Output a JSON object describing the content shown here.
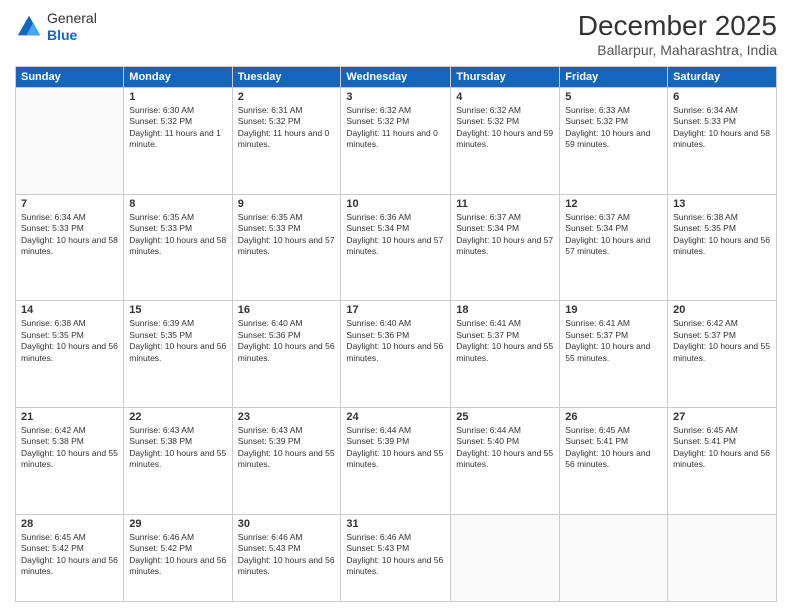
{
  "header": {
    "logo_general": "General",
    "logo_blue": "Blue",
    "month_year": "December 2025",
    "location": "Ballarpur, Maharashtra, India"
  },
  "days_of_week": [
    "Sunday",
    "Monday",
    "Tuesday",
    "Wednesday",
    "Thursday",
    "Friday",
    "Saturday"
  ],
  "weeks": [
    [
      {
        "num": "",
        "empty": true
      },
      {
        "num": "1",
        "sunrise": "6:30 AM",
        "sunset": "5:32 PM",
        "daylight": "11 hours and 1 minute."
      },
      {
        "num": "2",
        "sunrise": "6:31 AM",
        "sunset": "5:32 PM",
        "daylight": "11 hours and 0 minutes."
      },
      {
        "num": "3",
        "sunrise": "6:32 AM",
        "sunset": "5:32 PM",
        "daylight": "11 hours and 0 minutes."
      },
      {
        "num": "4",
        "sunrise": "6:32 AM",
        "sunset": "5:32 PM",
        "daylight": "10 hours and 59 minutes."
      },
      {
        "num": "5",
        "sunrise": "6:33 AM",
        "sunset": "5:32 PM",
        "daylight": "10 hours and 59 minutes."
      },
      {
        "num": "6",
        "sunrise": "6:34 AM",
        "sunset": "5:33 PM",
        "daylight": "10 hours and 58 minutes."
      }
    ],
    [
      {
        "num": "7",
        "sunrise": "6:34 AM",
        "sunset": "5:33 PM",
        "daylight": "10 hours and 58 minutes."
      },
      {
        "num": "8",
        "sunrise": "6:35 AM",
        "sunset": "5:33 PM",
        "daylight": "10 hours and 58 minutes."
      },
      {
        "num": "9",
        "sunrise": "6:35 AM",
        "sunset": "5:33 PM",
        "daylight": "10 hours and 57 minutes."
      },
      {
        "num": "10",
        "sunrise": "6:36 AM",
        "sunset": "5:34 PM",
        "daylight": "10 hours and 57 minutes."
      },
      {
        "num": "11",
        "sunrise": "6:37 AM",
        "sunset": "5:34 PM",
        "daylight": "10 hours and 57 minutes."
      },
      {
        "num": "12",
        "sunrise": "6:37 AM",
        "sunset": "5:34 PM",
        "daylight": "10 hours and 57 minutes."
      },
      {
        "num": "13",
        "sunrise": "6:38 AM",
        "sunset": "5:35 PM",
        "daylight": "10 hours and 56 minutes."
      }
    ],
    [
      {
        "num": "14",
        "sunrise": "6:38 AM",
        "sunset": "5:35 PM",
        "daylight": "10 hours and 56 minutes."
      },
      {
        "num": "15",
        "sunrise": "6:39 AM",
        "sunset": "5:35 PM",
        "daylight": "10 hours and 56 minutes."
      },
      {
        "num": "16",
        "sunrise": "6:40 AM",
        "sunset": "5:36 PM",
        "daylight": "10 hours and 56 minutes."
      },
      {
        "num": "17",
        "sunrise": "6:40 AM",
        "sunset": "5:36 PM",
        "daylight": "10 hours and 56 minutes."
      },
      {
        "num": "18",
        "sunrise": "6:41 AM",
        "sunset": "5:37 PM",
        "daylight": "10 hours and 55 minutes."
      },
      {
        "num": "19",
        "sunrise": "6:41 AM",
        "sunset": "5:37 PM",
        "daylight": "10 hours and 55 minutes."
      },
      {
        "num": "20",
        "sunrise": "6:42 AM",
        "sunset": "5:37 PM",
        "daylight": "10 hours and 55 minutes."
      }
    ],
    [
      {
        "num": "21",
        "sunrise": "6:42 AM",
        "sunset": "5:38 PM",
        "daylight": "10 hours and 55 minutes."
      },
      {
        "num": "22",
        "sunrise": "6:43 AM",
        "sunset": "5:38 PM",
        "daylight": "10 hours and 55 minutes."
      },
      {
        "num": "23",
        "sunrise": "6:43 AM",
        "sunset": "5:39 PM",
        "daylight": "10 hours and 55 minutes."
      },
      {
        "num": "24",
        "sunrise": "6:44 AM",
        "sunset": "5:39 PM",
        "daylight": "10 hours and 55 minutes."
      },
      {
        "num": "25",
        "sunrise": "6:44 AM",
        "sunset": "5:40 PM",
        "daylight": "10 hours and 55 minutes."
      },
      {
        "num": "26",
        "sunrise": "6:45 AM",
        "sunset": "5:41 PM",
        "daylight": "10 hours and 56 minutes."
      },
      {
        "num": "27",
        "sunrise": "6:45 AM",
        "sunset": "5:41 PM",
        "daylight": "10 hours and 56 minutes."
      }
    ],
    [
      {
        "num": "28",
        "sunrise": "6:45 AM",
        "sunset": "5:42 PM",
        "daylight": "10 hours and 56 minutes."
      },
      {
        "num": "29",
        "sunrise": "6:46 AM",
        "sunset": "5:42 PM",
        "daylight": "10 hours and 56 minutes."
      },
      {
        "num": "30",
        "sunrise": "6:46 AM",
        "sunset": "5:43 PM",
        "daylight": "10 hours and 56 minutes."
      },
      {
        "num": "31",
        "sunrise": "6:46 AM",
        "sunset": "5:43 PM",
        "daylight": "10 hours and 56 minutes."
      },
      {
        "num": "",
        "empty": true
      },
      {
        "num": "",
        "empty": true
      },
      {
        "num": "",
        "empty": true
      }
    ]
  ]
}
